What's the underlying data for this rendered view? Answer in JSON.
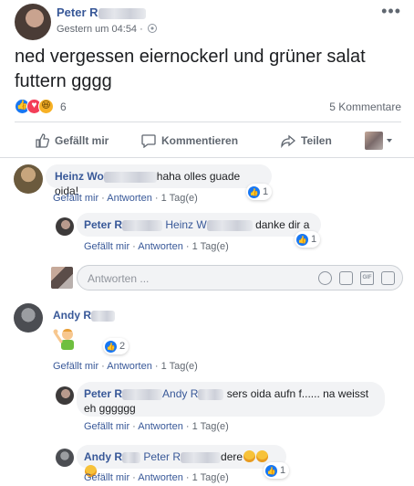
{
  "post": {
    "author": "Peter R",
    "time": "Gestern um 04:54",
    "text": "ned vergessen eiernockerl und grüner salat futtern gggg",
    "reaction_count": "6",
    "comment_count": "5 Kommentare"
  },
  "actions": {
    "like": "Gefällt mir",
    "comment": "Kommentieren",
    "share": "Teilen"
  },
  "comments": [
    {
      "author": "Heinz Wo",
      "text": "haha olles guade oida!",
      "like_label": "Gefällt mir",
      "reply_label": "Antworten",
      "age": "1 Tag(e)",
      "reactions": "1"
    },
    {
      "author": "Peter R",
      "mention": "Heinz W",
      "text": "danke dir a",
      "like_label": "Gefällt mir",
      "reply_label": "Antworten",
      "age": "1 Tag(e)",
      "reactions": "1"
    },
    {
      "author": "Andy R",
      "like_label": "Gefällt mir",
      "reply_label": "Antworten",
      "age": "1 Tag(e)",
      "reactions": "2"
    },
    {
      "author": "Peter R",
      "mention": "Andy R",
      "text": "sers oida aufn f...... na weisst eh gggggg",
      "like_label": "Gefällt mir",
      "reply_label": "Antworten",
      "age": "1 Tag(e)"
    },
    {
      "author": "Andy R",
      "mention": "Peter R",
      "text": "dere",
      "like_label": "Gefällt mir",
      "reply_label": "Antworten",
      "age": "1 Tag(e)",
      "reactions": "1"
    }
  ],
  "reply_box": {
    "placeholder": "Antworten ..."
  },
  "meta_separator": " · ",
  "colors": {
    "link": "#385898",
    "like_blue": "#1877f2",
    "bubble": "#f2f3f5"
  }
}
